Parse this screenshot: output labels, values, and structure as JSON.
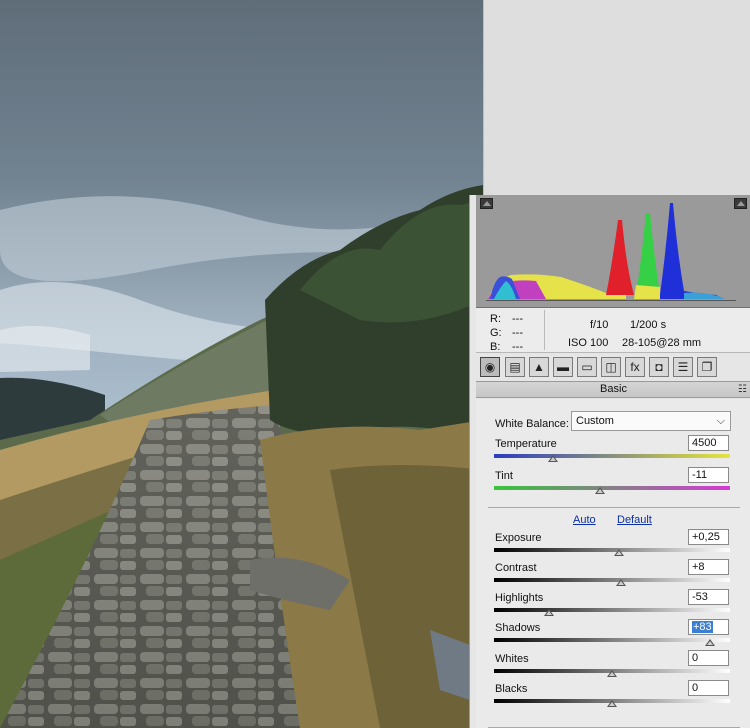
{
  "readout": {
    "r_label": "R:",
    "r_value": "---",
    "g_label": "G:",
    "g_value": "---",
    "b_label": "B:",
    "b_value": "---",
    "aperture": "f/10",
    "shutter": "1/200 s",
    "iso": "ISO 100",
    "lens": "28-105@28 mm"
  },
  "tool_icons": [
    "basic-aperture-icon",
    "tone-curve-icon",
    "detail-icon",
    "hsl-icon",
    "split-toning-icon",
    "lens-corrections-icon",
    "effects-icon",
    "camera-calibration-icon",
    "presets-icon",
    "snapshots-icon"
  ],
  "tool_glyphs": [
    "◉",
    "▤",
    "▲",
    "▬",
    "▭",
    "◫",
    "fx",
    "◘",
    "☰",
    "❐"
  ],
  "panel": {
    "title": "Basic",
    "white_balance_label": "White Balance:",
    "white_balance_value": "Custom",
    "auto_link": "Auto",
    "default_link": "Default"
  },
  "sliders": {
    "temperature": {
      "label": "Temperature",
      "value": "4500",
      "position": 0.25
    },
    "tint": {
      "label": "Tint",
      "value": "-11",
      "position": 0.45
    },
    "exposure": {
      "label": "Exposure",
      "value": "+0,25",
      "position": 0.53
    },
    "contrast": {
      "label": "Contrast",
      "value": "+8",
      "position": 0.54
    },
    "highlights": {
      "label": "Highlights",
      "value": "-53",
      "position": 0.235
    },
    "shadows": {
      "label": "Shadows",
      "value": "+83",
      "position": 0.915
    },
    "whites": {
      "label": "Whites",
      "value": "0",
      "position": 0.5
    },
    "blacks": {
      "label": "Blacks",
      "value": "0",
      "position": 0.5
    }
  },
  "colors": {
    "temperature_track": [
      "#2b3cc0",
      "#e5e53a"
    ],
    "tint_track": [
      "#39c43a",
      "#d43ad4"
    ],
    "tone_track": [
      "#000000",
      "#ffffff"
    ],
    "selection": "#3a7fd5",
    "link": "#0b2fa8"
  }
}
